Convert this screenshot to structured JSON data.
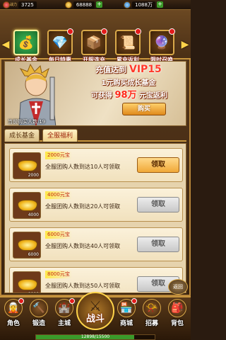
{
  "topbar": {
    "level_label": "战力",
    "power": "3725",
    "gold": "68888",
    "diamond": "1088",
    "diamond_suffix": "万",
    "plus": "+"
  },
  "tabs": [
    {
      "label": "成长基金",
      "icon": "treasure-icon",
      "active": true
    },
    {
      "label": "每日特惠",
      "icon": "gem-bag-icon",
      "active": false
    },
    {
      "label": "开服连充",
      "icon": "chest-icon",
      "active": false
    },
    {
      "label": "累充返利",
      "icon": "scroll-icon",
      "active": false
    },
    {
      "label": "限时召唤",
      "icon": "summon-icon",
      "active": false
    }
  ],
  "banner": {
    "promo_prefix": "充值达到",
    "promo_vip": "VIP15",
    "promo_line2": "1元购买成长基金",
    "promo_line3_prefix": "可获得",
    "promo_line3_amount": "98万",
    "promo_line3_suffix": "元宝返利",
    "buy_label": "购买",
    "recharge_status": "当前购买人数:19"
  },
  "subtabs": [
    {
      "label": "成长基金",
      "active": false
    },
    {
      "label": "全服福利",
      "active": true
    }
  ],
  "rewards": [
    {
      "title": "2000元宝",
      "desc": "全服团购人数到达10人可领取",
      "count": "2000",
      "button": "领取",
      "enabled": true
    },
    {
      "title": "4000元宝",
      "desc": "全服团购人数到达20人可领取",
      "count": "4000",
      "button": "领取",
      "enabled": false
    },
    {
      "title": "6000元宝",
      "desc": "全服团购人数到达40人可领取",
      "count": "6000",
      "button": "领取",
      "enabled": false
    },
    {
      "title": "8000元宝",
      "desc": "全服团购人数到达50人可领取",
      "count": "8000",
      "button": "领取",
      "enabled": false
    }
  ],
  "return_label": "返回",
  "nav": [
    {
      "label": "角色",
      "icon": "character-icon",
      "badge": true
    },
    {
      "label": "锻造",
      "icon": "anvil-icon",
      "badge": false
    },
    {
      "label": "主城",
      "icon": "castle-icon",
      "badge": true
    },
    {
      "label": "战斗",
      "icon": "swords-icon",
      "badge": false
    },
    {
      "label": "商城",
      "icon": "shop-icon",
      "badge": true
    },
    {
      "label": "招募",
      "icon": "recruit-icon",
      "badge": false
    },
    {
      "label": "背包",
      "icon": "bag-icon",
      "badge": false
    }
  ],
  "exp": {
    "text": "12898/15500",
    "fraction": 0.83
  }
}
